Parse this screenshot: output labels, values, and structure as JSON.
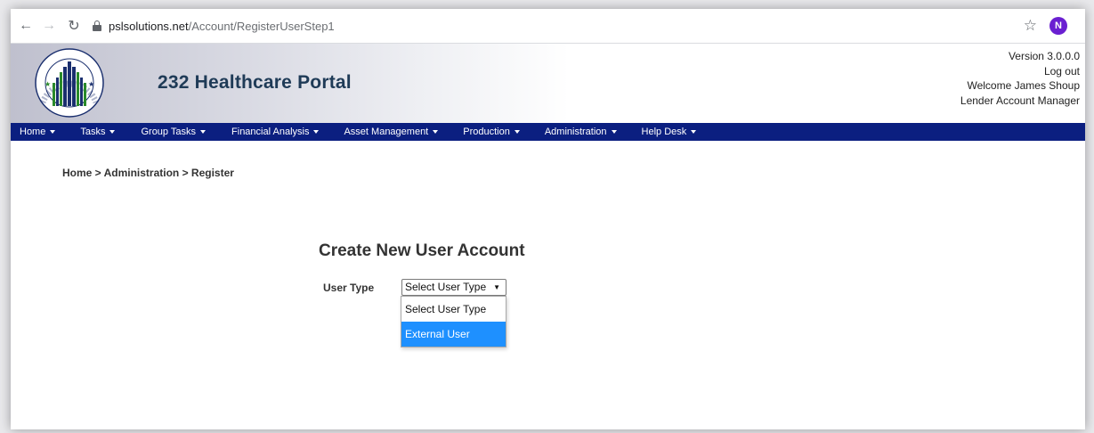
{
  "browser": {
    "url_host": "pslsolutions.net",
    "url_path": "/Account/RegisterUserStep1",
    "profile_initial": "N",
    "icons": [
      "back-arrow-icon",
      "forward-arrow-icon",
      "reload-icon",
      "lock-icon",
      "bookmark-star-icon",
      "more-menu-icon"
    ]
  },
  "header": {
    "title": "232 Healthcare Portal",
    "version": "Version 3.0.0.0",
    "logout": "Log out",
    "welcome": "Welcome James Shoup",
    "role": "Lender Account Manager",
    "seal_text": "DEPARTMENT OF HOUSING AND URBAN DEVELOPMENT",
    "seal_prefix": "U.S."
  },
  "nav": {
    "items": [
      {
        "label": "Home"
      },
      {
        "label": "Tasks"
      },
      {
        "label": "Group Tasks"
      },
      {
        "label": "Financial Analysis"
      },
      {
        "label": "Asset Management"
      },
      {
        "label": "Production"
      },
      {
        "label": "Administration"
      },
      {
        "label": "Help Desk"
      }
    ]
  },
  "content": {
    "breadcrumb": "Home > Administration > Register",
    "title": "Create New User Account",
    "user_type_label": "User Type",
    "select_value": "Select User Type",
    "options": [
      "Select User Type",
      "External User"
    ],
    "highlighted_option": "External User"
  },
  "colors": {
    "navbar": "#0b1f80",
    "highlight": "#1e90ff",
    "profile": "#6a1fd1"
  }
}
